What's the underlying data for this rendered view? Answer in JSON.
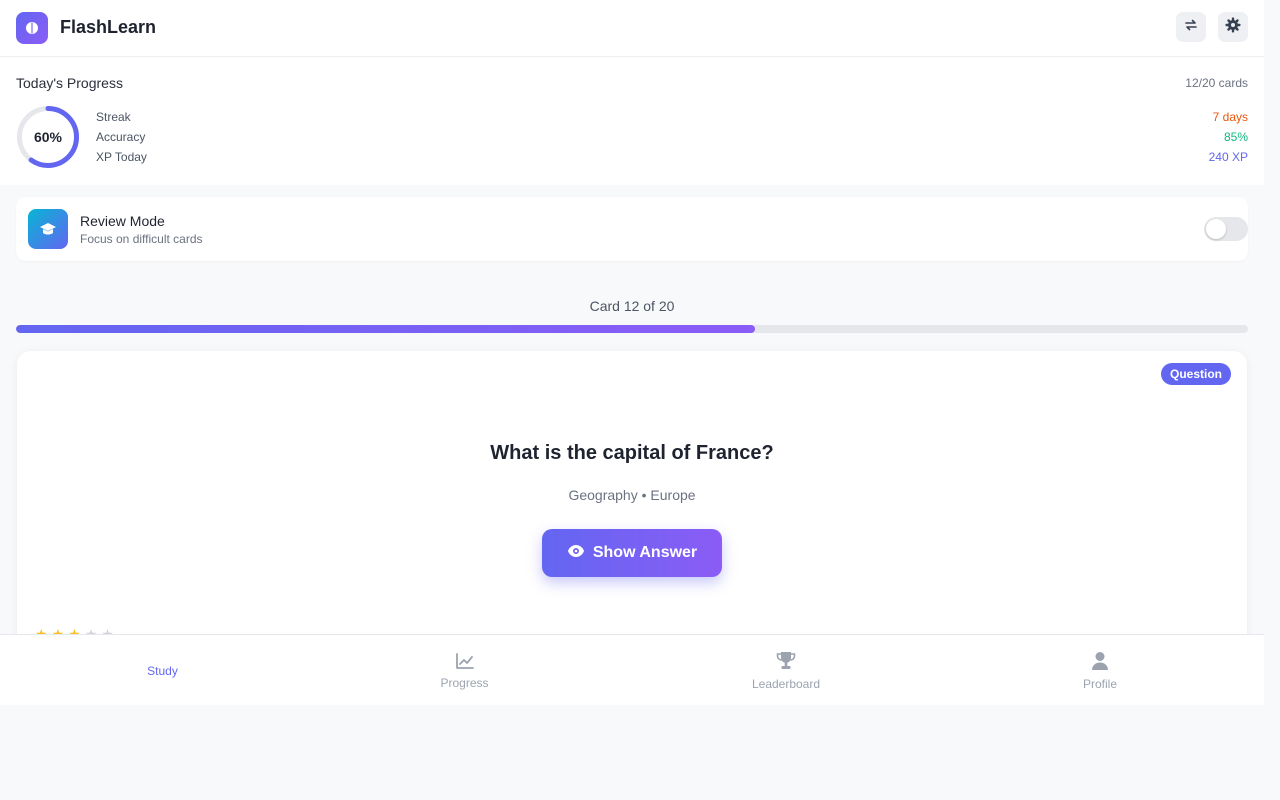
{
  "header": {
    "title": "FlashLearn",
    "logo_icon": "brain-icon",
    "buttons": [
      {
        "icon": "refresh-icon"
      },
      {
        "icon": "gear-icon"
      }
    ]
  },
  "progress": {
    "title": "Today's Progress",
    "count": "12/20 cards",
    "percent_label": "60%",
    "percent": 0.6,
    "stats": [
      {
        "label": "Streak",
        "value": "7 days",
        "color": "#ea580c"
      },
      {
        "label": "Accuracy",
        "value": "85%",
        "color": "#10b981"
      },
      {
        "label": "XP Today",
        "value": "240 XP",
        "color": "#6366f1"
      }
    ]
  },
  "review_mode": {
    "title": "Review Mode",
    "subtitle": "Focus on difficult cards",
    "icon": "graduation-cap-icon",
    "enabled": false
  },
  "deck": {
    "counter": "Card 12 of 20",
    "progress": 0.6
  },
  "card": {
    "badge": "Question",
    "question": "What is the capital of France?",
    "category": "Geography • Europe",
    "button_label": "Show Answer",
    "button_icon": "eye-icon",
    "difficulty_stars": 3,
    "difficulty_max": 5
  },
  "nav": {
    "items": [
      {
        "label": "Study",
        "icon": "book-icon",
        "active": true
      },
      {
        "label": "Progress",
        "icon": "chart-line-icon",
        "active": false
      },
      {
        "label": "Leaderboard",
        "icon": "trophy-icon",
        "active": false
      },
      {
        "label": "Profile",
        "icon": "user-icon",
        "active": false
      }
    ]
  },
  "colors": {
    "accent": "#6366f1",
    "accent2": "#8b5cf6"
  }
}
